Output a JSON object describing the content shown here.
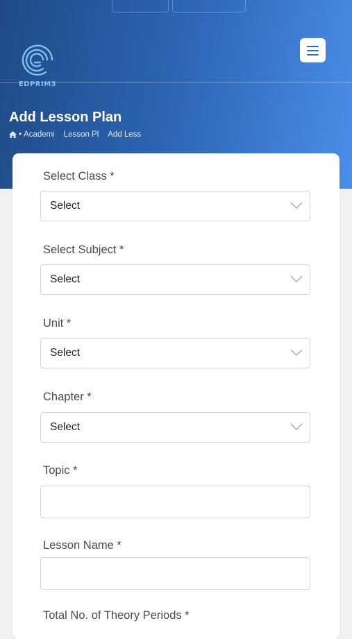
{
  "header": {
    "logo_text": "EDPRIM3",
    "page_title": "Add Lesson Plan",
    "breadcrumb": [
      "Academi",
      "Lesson Pl",
      "Add Less"
    ]
  },
  "form": {
    "select_class": {
      "label": "Select Class *",
      "value": "Select"
    },
    "select_subject": {
      "label": "Select Subject *",
      "value": "Select"
    },
    "unit": {
      "label": "Unit *",
      "value": "Select"
    },
    "chapter": {
      "label": "Chapter *",
      "value": "Select"
    },
    "topic": {
      "label": "Topic *",
      "value": "",
      "placeholder": ""
    },
    "lesson_name": {
      "label": "Lesson Name *",
      "value": "",
      "placeholder": ""
    },
    "theory_periods": {
      "label": "Total No. of Theory Periods *"
    }
  },
  "icons": [
    "hamburger-menu-icon",
    "home-icon",
    "chevron-down-icon"
  ],
  "colors": {
    "header_start": "#1f4a86",
    "header_end": "#4a8eea",
    "menu_icon": "#2b6cb8",
    "card_bg": "#ffffff",
    "page_bg": "#f1f1f3"
  }
}
